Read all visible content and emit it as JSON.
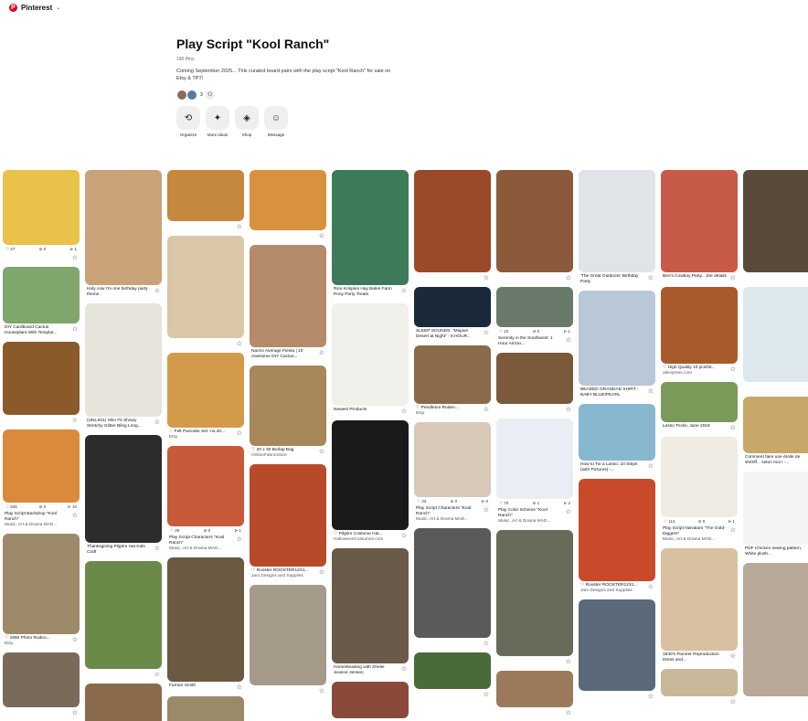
{
  "app": {
    "name": "Pinterest",
    "logo_letter": "P",
    "caret": "⌄"
  },
  "board": {
    "title": "Play Script \"Kool Ranch\"",
    "pins_count": "190 Pins",
    "description": "Coming September 2025... This curated board pairs with the play script \"Kool Ranch\" for sale on Etsy & TPT!",
    "collaborator_count": "3"
  },
  "actions": [
    {
      "label": "Organize",
      "icon": "⟲"
    },
    {
      "label": "More ideas",
      "icon": "✦"
    },
    {
      "label": "Shop",
      "icon": "◈"
    },
    {
      "label": "Message",
      "icon": "☺"
    }
  ],
  "colors": {
    "brand": "#e60023",
    "action_bg": "#efefef"
  },
  "columns": [
    [
      {
        "h": 82,
        "color": "#e8c24a",
        "stats": [
          "♡ 47",
          "⊘ 0",
          "⊳ 1"
        ]
      },
      {
        "h": 62,
        "color": "#7fa66b",
        "text": "DIY Cardboard Cactus Houseplant With Templat..."
      },
      {
        "h": 80,
        "color": "#8b5a2b"
      },
      {
        "h": 80,
        "color": "#d98a3a",
        "stats": [
          "♡ 525",
          "⊘ 0",
          "⊳ 10"
        ],
        "text": "Play Script Backdrop \"Kool Ranch\"",
        "source": "Music, Art & Drama MAD..."
      },
      {
        "h": 110,
        "color": "#9c8a6a",
        "text": "♡ 1950 Photo Rodeo...",
        "source": "Etsy"
      },
      {
        "h": 60,
        "color": "#7a6a5a"
      }
    ],
    [
      {
        "h": 126,
        "color": "#c9a27a",
        "text": "Holy cow I'm one birthday party theme"
      },
      {
        "h": 124,
        "color": "#e7e4dc",
        "text": "(UNLS01) Slim Fit Showy Stretchy Glitter Bling Long..."
      },
      {
        "h": 118,
        "color": "#2c2c2c",
        "text": "Thanksgiving Pilgrim Hat Kids Craft"
      },
      {
        "h": 118,
        "color": "#6b8a4a"
      },
      {
        "h": 60,
        "color": "#8a6a4a"
      }
    ],
    [
      {
        "h": 56,
        "color": "#c6873f"
      },
      {
        "h": 112,
        "color": "#d9c7a8"
      },
      {
        "h": 82,
        "color": "#d29a4a",
        "text": "♡ Felt Pancake Set -no.40...",
        "source": "Etsy"
      },
      {
        "h": 88,
        "color": "#c85a3a",
        "stats": [
          "♡ 29",
          "⊘ 0",
          "⊳ 1"
        ],
        "text": "Play Script Characters \"Kool Ranch\"",
        "source": "Music, Art & Drama MAD..."
      },
      {
        "h": 136,
        "color": "#6a5a42",
        "text": "Farmer Smith"
      },
      {
        "h": 40,
        "color": "#9a8a6a"
      }
    ],
    [
      {
        "h": 66,
        "color": "#d8913c"
      },
      {
        "h": 112,
        "color": "#b58a6a",
        "text": "Nacho Average Fiesta | 10 Awesome DIY Cactus..."
      },
      {
        "h": 88,
        "color": "#a8875a",
        "text": "♡ 20 x 30 Burlap Bag",
        "source": "OnlineFabricStore"
      },
      {
        "h": 112,
        "color": "#b84a2a",
        "text": "♡ Rooster ROOSTER12X1...",
        "source": "Jam Designs and Supplies"
      },
      {
        "h": 110,
        "color": "#a69a8a"
      }
    ],
    [
      {
        "h": 126,
        "color": "#3c7a5a",
        "text": "Rice Krispies Hay Bales Farm Pony Party Treats"
      },
      {
        "h": 112,
        "color": "#f2f0ec",
        "text": "Newest Products"
      },
      {
        "h": 120,
        "color": "#1a1a1a",
        "text": "♡ Pilgrim Costume Hat...",
        "source": "HalloweenCostumes.com"
      },
      {
        "h": 126,
        "color": "#6a5a4a",
        "text": "Homesteading with Shelei Jeanne Jensen"
      },
      {
        "h": 40,
        "color": "#8a4a3a"
      }
    ],
    [
      {
        "h": 112,
        "color": "#9a4a2a"
      },
      {
        "h": 44,
        "color": "#1a2a3a",
        "text": "SLEEP SOUNDS: \"Mojave Desert at Night\" - 8 HOUR..."
      },
      {
        "h": 64,
        "color": "#8a6a4a",
        "text": "♡ Pendleton Rodeo...",
        "source": "Etsy"
      },
      {
        "h": 82,
        "color": "#d8c8b8",
        "stats": [
          "♡ 33",
          "⊘ 0",
          "⊳ 0"
        ],
        "text": "Play Script Characters \"Kool Ranch\"",
        "source": "Music, Art & Drama MAD..."
      },
      {
        "h": 120,
        "color": "#5a5a5a"
      },
      {
        "h": 40,
        "color": "#4a6a3a"
      }
    ],
    [
      {
        "h": 112,
        "color": "#8a5a3a"
      },
      {
        "h": 44,
        "color": "#6a7a6a",
        "stats": [
          "♡ 22",
          "⊘ 0",
          "⊳ 1"
        ],
        "text": "Serenity in the Southwest: 1 Hour Arizon..."
      },
      {
        "h": 56,
        "color": "#7a5a3a"
      },
      {
        "h": 88,
        "color": "#e8eef4",
        "stats": [
          "♡ 70",
          "⊘ 1",
          "⊳ 2"
        ],
        "text": "Play Color Scheme \"Kool Ranch\"",
        "source": "Music, Art & Drama MAD..."
      },
      {
        "h": 138,
        "color": "#6a6a5a"
      },
      {
        "h": 40,
        "color": "#9a7a5a"
      }
    ],
    [
      {
        "h": 112,
        "color": "#e0e4e8",
        "text": "'The Great Outdoors' Birthday Party"
      },
      {
        "h": 104,
        "color": "#b8c8d8",
        "text": "BEADED GRANDAD SHIRT - BABY BLUE/PEARL"
      },
      {
        "h": 62,
        "color": "#88b8d0",
        "text": "How to Tie a Lasso: 10 Steps (with Pictures) -..."
      },
      {
        "h": 112,
        "color": "#c84a2a",
        "text": "♡ Rooster ROOSTER12X1...",
        "source": "Jam Designs and Supplies"
      },
      {
        "h": 100,
        "color": "#5a6a7a"
      }
    ],
    [
      {
        "h": 112,
        "color": "#c85a4a",
        "text": "Ben's Cowboy Party....the details"
      },
      {
        "h": 84,
        "color": "#a85a2a",
        "text": "♡ High Quality 10 pcs/lot...",
        "source": "aliexpress.com"
      },
      {
        "h": 44,
        "color": "#7a9a5a",
        "text": "Lasso Tricks, June 2019"
      },
      {
        "h": 88,
        "color": "#f0ece4",
        "stats": [
          "♡ 112",
          "⊘ 0",
          "⊳ 1"
        ],
        "text": "Play Script Narrators \"The Gold-Diggers\"",
        "source": "Music, Art & Drama MAD..."
      },
      {
        "h": 112,
        "color": "#d8c0a0",
        "text": "1840's Pioneer Reproduction Dress and..."
      },
      {
        "h": 30,
        "color": "#c8b89a"
      }
    ],
    [
      {
        "h": 112,
        "color": "#5a4a3a"
      },
      {
        "h": 104,
        "color": "#dce8ec"
      },
      {
        "h": 62,
        "color": "#c8a868",
        "text": "Comment faire une étoile de shériff... selon moi ! -..."
      },
      {
        "h": 80,
        "color": "#f4f4f4",
        "text": "PDF Chicken sewing pattern, White plush..."
      },
      {
        "h": 146,
        "color": "#b8a898"
      }
    ]
  ]
}
